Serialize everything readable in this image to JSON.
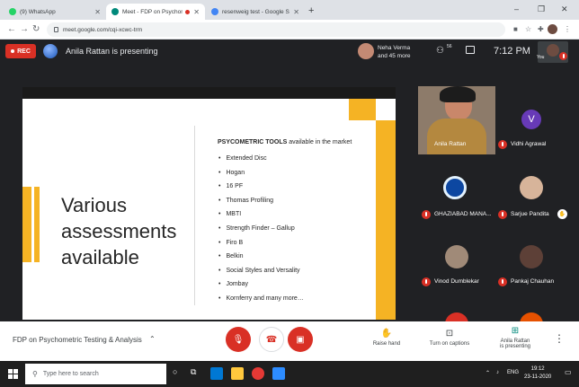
{
  "browser": {
    "tabs": [
      {
        "title": "(9) WhatsApp",
        "favicon_color": "#25d366"
      },
      {
        "title": "Meet - FDP on Psychometric",
        "favicon_color": "#00897b",
        "active": true
      },
      {
        "title": "resenweig test - Google Search",
        "favicon_color": "#4285f4"
      }
    ],
    "new_tab": "+",
    "window_controls": [
      "–",
      "❐",
      "✕"
    ],
    "url": "meet.google.com/cqi-xcwc-trm"
  },
  "meet": {
    "rec_label": "REC",
    "presenting": "Anila Rattan is presenting",
    "top_participant": {
      "line1": "Neha Verma",
      "line2": "and 45 more"
    },
    "people_count": "56",
    "clock": "7:12 PM",
    "self_label": "You"
  },
  "slide": {
    "title_lines": [
      "Various",
      "assessments",
      "available"
    ],
    "heading_bold": "PSYCOMETRIC TOOLS",
    "heading_rest": " available in the market",
    "tools": [
      "Extended Disc",
      "Hogan",
      "16 PF",
      "Thomas Profiling",
      "MBTI",
      "Strength Finder – Gallup",
      "Firo B",
      "Belkin",
      "Social Styles and Versality",
      "Jombay",
      "Kornferry and many more…"
    ],
    "colors": {
      "accent": "#f5b324"
    }
  },
  "participants": [
    {
      "name": "Anila Rattan",
      "muted": false
    },
    {
      "name": "Vidhi Agrawal",
      "initial": "V",
      "muted": true,
      "avatar_color": "#673ab7"
    },
    {
      "name": "GHAZIABAD MANA...",
      "muted": true
    },
    {
      "name": "Sarjue Pandita",
      "muted": true
    },
    {
      "name": "Vinod Dumblekar",
      "muted": true
    },
    {
      "name": "Pankaj Chauhan",
      "muted": true
    }
  ],
  "controls": {
    "meeting_title": "FDP on Psychometric Testing & Analysis",
    "raise_hand": "Raise hand",
    "captions": "Turn on captions",
    "presenting_line1": "Anila Rattan",
    "presenting_line2": "is presenting"
  },
  "taskbar": {
    "search_placeholder": "Type here to search",
    "lang": "ENG",
    "time": "19:12",
    "date": "23-11-2020"
  }
}
